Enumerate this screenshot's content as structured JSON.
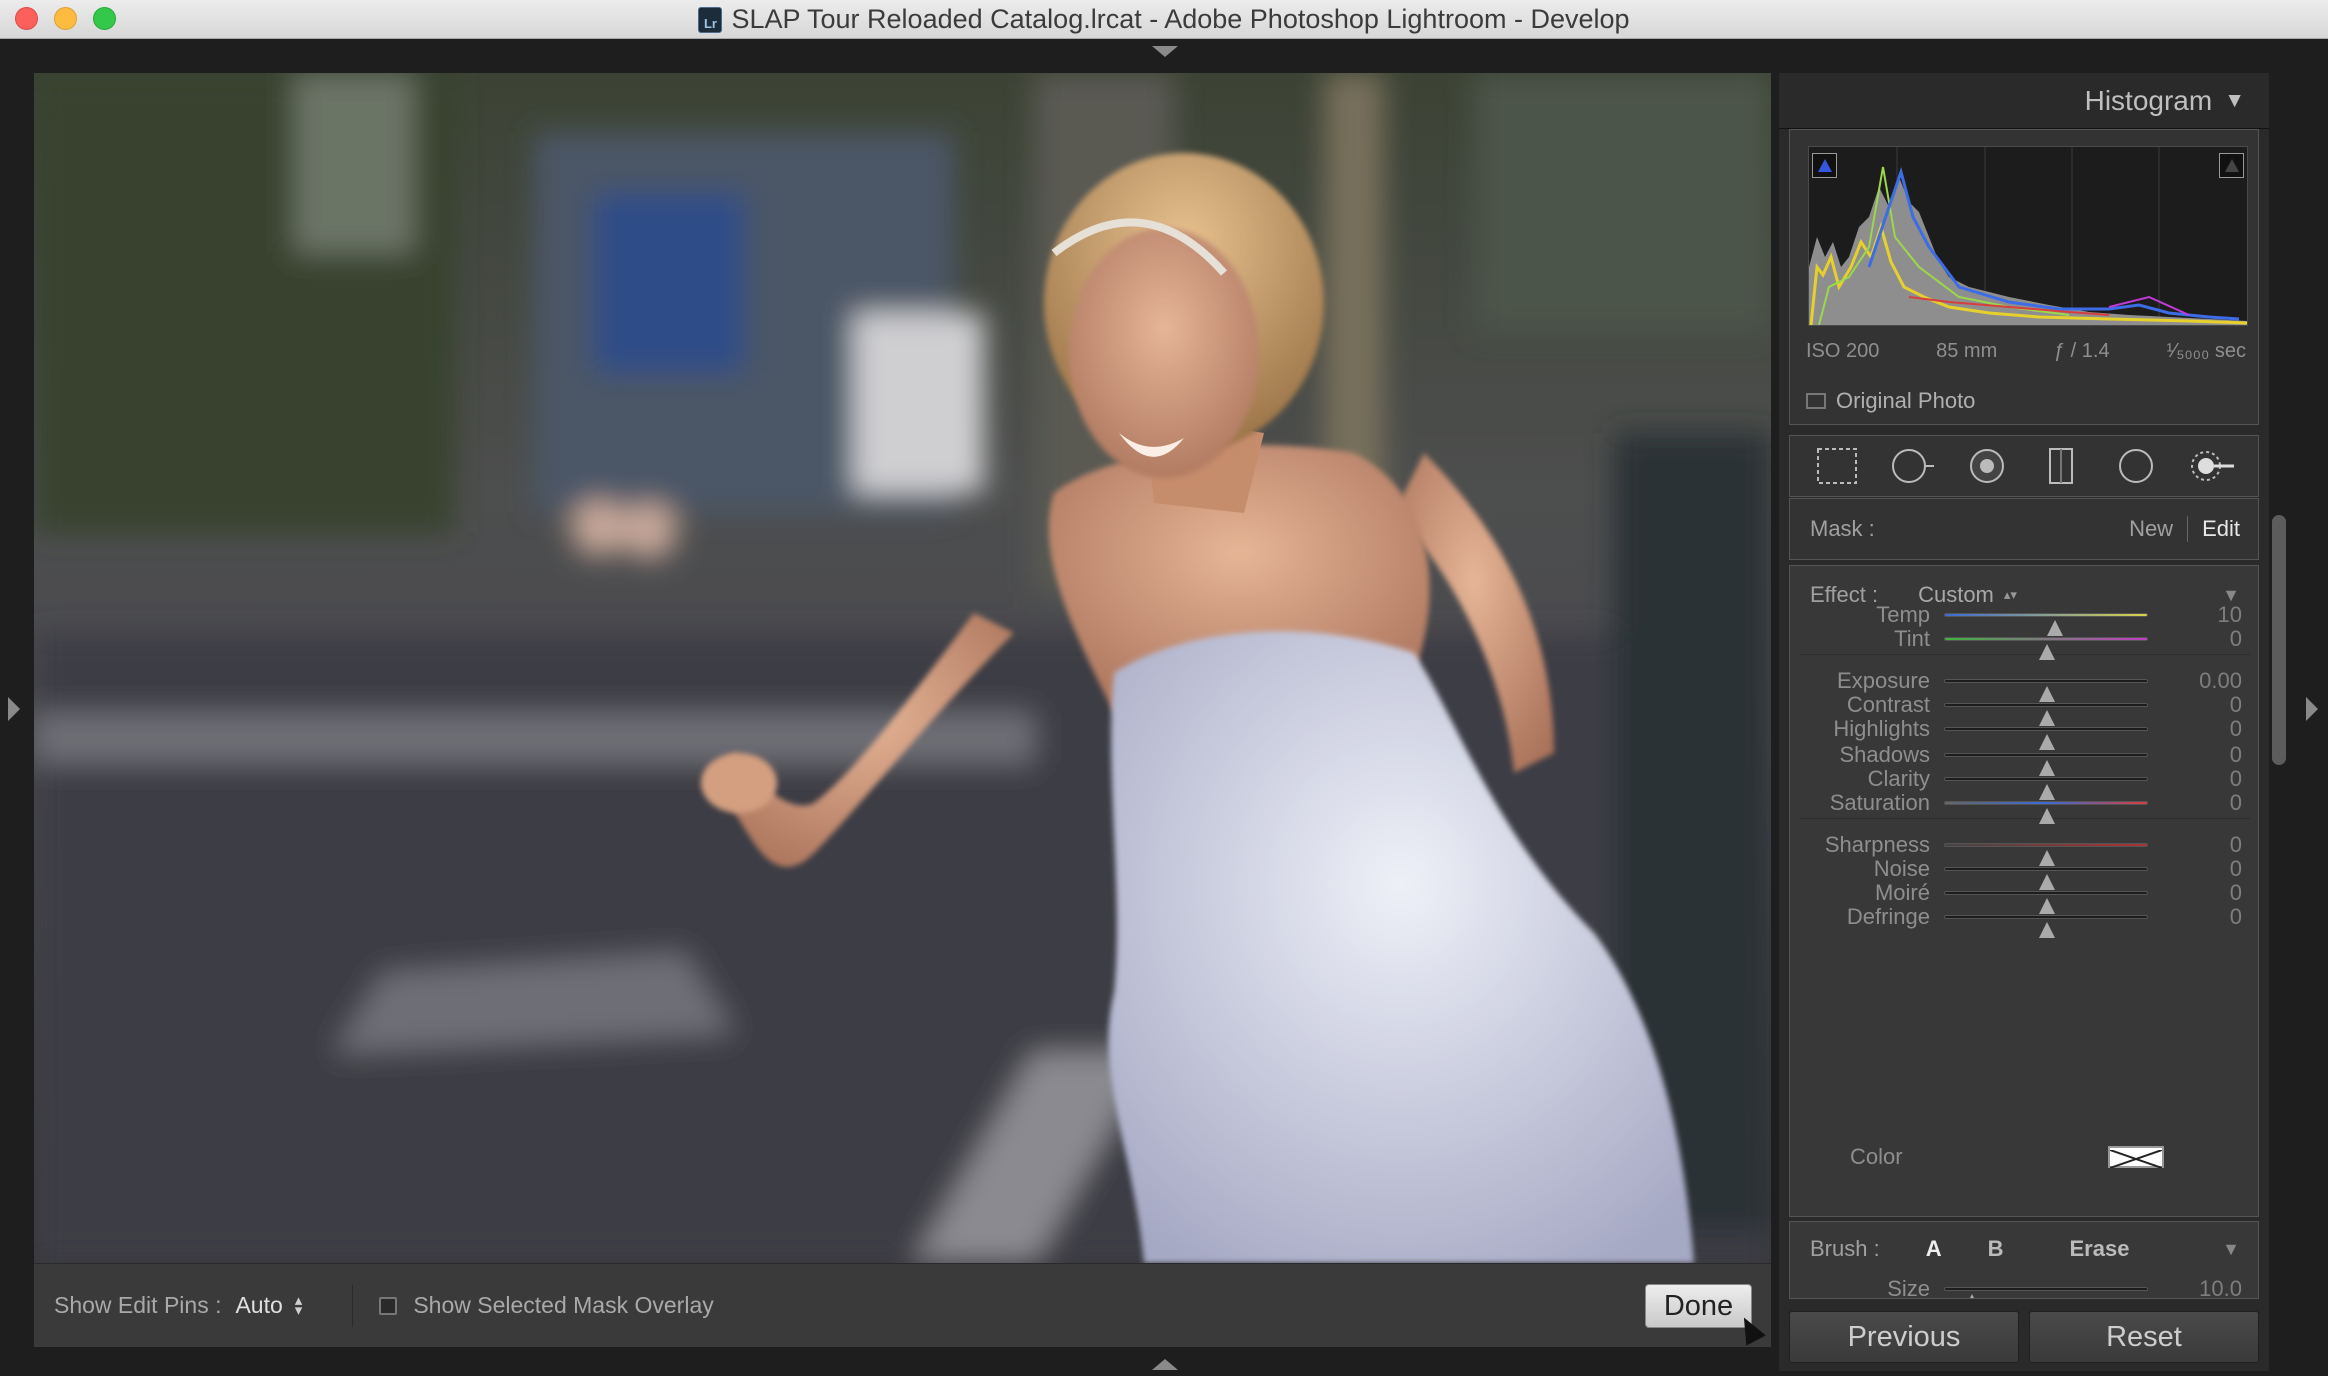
{
  "window": {
    "title": "SLAP Tour Reloaded Catalog.lrcat - Adobe Photoshop Lightroom - Develop",
    "app_icon": "Lr"
  },
  "histogram": {
    "title": "Histogram",
    "iso": "ISO 200",
    "focal": "85 mm",
    "aperture": "ƒ / 1.4",
    "shutter": "¹⁄₅₀₀₀ sec",
    "original_photo": "Original Photo"
  },
  "mask": {
    "label": "Mask :",
    "new": "New",
    "edit": "Edit"
  },
  "effect": {
    "label": "Effect :",
    "value": "Custom"
  },
  "sliders": [
    {
      "label": "Temp",
      "value": "10",
      "pos": 0.54
    },
    {
      "label": "Tint",
      "value": "0",
      "pos": 0.5
    },
    {
      "label": "Exposure",
      "value": "0.00",
      "pos": 0.5
    },
    {
      "label": "Contrast",
      "value": "0",
      "pos": 0.5
    },
    {
      "label": "Highlights",
      "value": "0",
      "pos": 0.5
    },
    {
      "label": "Shadows",
      "value": "0",
      "pos": 0.5
    },
    {
      "label": "Clarity",
      "value": "0",
      "pos": 0.5
    },
    {
      "label": "Saturation",
      "value": "0",
      "pos": 0.5
    },
    {
      "label": "Sharpness",
      "value": "0",
      "pos": 0.5
    },
    {
      "label": "Noise",
      "value": "0",
      "pos": 0.5
    },
    {
      "label": "Moiré",
      "value": "0",
      "pos": 0.5
    },
    {
      "label": "Defringe",
      "value": "0",
      "pos": 0.5
    }
  ],
  "color": {
    "label": "Color"
  },
  "brush": {
    "label": "Brush :",
    "a": "A",
    "b": "B",
    "erase": "Erase",
    "size_label": "Size",
    "size_value": "10.0",
    "size_pos": 0.13
  },
  "toolbar": {
    "edit_pins_label": "Show Edit Pins :",
    "edit_pins_value": "Auto",
    "mask_overlay_label": "Show Selected Mask Overlay",
    "done": "Done"
  },
  "buttons": {
    "previous": "Previous",
    "reset": "Reset"
  },
  "colors": {
    "panel": "#2a2a2a",
    "accent_clip": "#3756e0"
  }
}
